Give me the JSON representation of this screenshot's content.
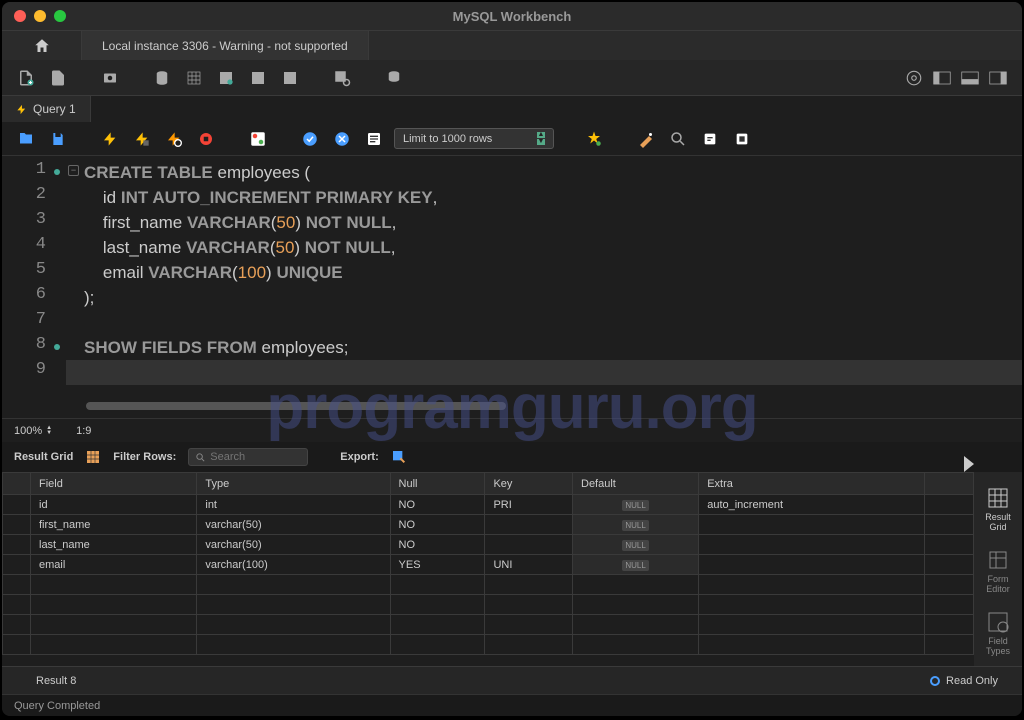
{
  "title": "MySQL Workbench",
  "connection_tab": "Local instance 3306 - Warning - not supported",
  "query_tab": "Query 1",
  "limit_dropdown": "Limit to 1000 rows",
  "zoom": "100%",
  "cursor_pos": "1:9",
  "result_grid_label": "Result Grid",
  "filter_label": "Filter Rows:",
  "search_placeholder": "Search",
  "export_label": "Export:",
  "code_lines": [
    {
      "n": 1,
      "dot": true,
      "tokens": [
        {
          "t": "CREATE TABLE ",
          "c": "kw"
        },
        {
          "t": "employees",
          "c": "id"
        },
        {
          "t": " (",
          "c": "id"
        }
      ]
    },
    {
      "n": 2,
      "tokens": [
        {
          "t": "    id ",
          "c": "id"
        },
        {
          "t": "INT AUTO_INCREMENT PRIMARY KEY",
          "c": "ty"
        },
        {
          "t": ",",
          "c": "id"
        }
      ]
    },
    {
      "n": 3,
      "tokens": [
        {
          "t": "    first_name ",
          "c": "id"
        },
        {
          "t": "VARCHAR",
          "c": "ty"
        },
        {
          "t": "(",
          "c": "id"
        },
        {
          "t": "50",
          "c": "num"
        },
        {
          "t": ") ",
          "c": "id"
        },
        {
          "t": "NOT NULL",
          "c": "ty"
        },
        {
          "t": ",",
          "c": "id"
        }
      ]
    },
    {
      "n": 4,
      "tokens": [
        {
          "t": "    last_name ",
          "c": "id"
        },
        {
          "t": "VARCHAR",
          "c": "ty"
        },
        {
          "t": "(",
          "c": "id"
        },
        {
          "t": "50",
          "c": "num"
        },
        {
          "t": ") ",
          "c": "id"
        },
        {
          "t": "NOT NULL",
          "c": "ty"
        },
        {
          "t": ",",
          "c": "id"
        }
      ]
    },
    {
      "n": 5,
      "tokens": [
        {
          "t": "    email ",
          "c": "id"
        },
        {
          "t": "VARCHAR",
          "c": "ty"
        },
        {
          "t": "(",
          "c": "id"
        },
        {
          "t": "100",
          "c": "num"
        },
        {
          "t": ") ",
          "c": "id"
        },
        {
          "t": "UNIQUE",
          "c": "ty"
        }
      ]
    },
    {
      "n": 6,
      "tokens": [
        {
          "t": ");",
          "c": "id"
        }
      ]
    },
    {
      "n": 7,
      "tokens": []
    },
    {
      "n": 8,
      "dot": true,
      "tokens": [
        {
          "t": "SHOW FIELDS FROM ",
          "c": "kw"
        },
        {
          "t": "employees",
          "c": "id"
        },
        {
          "t": ";",
          "c": "id"
        }
      ]
    },
    {
      "n": 9,
      "cursor": true,
      "tokens": []
    }
  ],
  "columns": [
    "Field",
    "Type",
    "Null",
    "Key",
    "Default",
    "Extra"
  ],
  "rows": [
    {
      "Field": "id",
      "Type": "int",
      "Null": "NO",
      "Key": "PRI",
      "Default": null,
      "Extra": "auto_increment"
    },
    {
      "Field": "first_name",
      "Type": "varchar(50)",
      "Null": "NO",
      "Key": "",
      "Default": null,
      "Extra": ""
    },
    {
      "Field": "last_name",
      "Type": "varchar(50)",
      "Null": "NO",
      "Key": "",
      "Default": null,
      "Extra": ""
    },
    {
      "Field": "email",
      "Type": "varchar(100)",
      "Null": "YES",
      "Key": "UNI",
      "Default": null,
      "Extra": ""
    }
  ],
  "sidebar_items": [
    {
      "label": "Result\nGrid",
      "active": true
    },
    {
      "label": "Form\nEditor"
    },
    {
      "label": "Field\nTypes"
    }
  ],
  "result_tab": "Result 8",
  "readonly": "Read Only",
  "footer": "Query Completed",
  "watermark": "programguru.org"
}
